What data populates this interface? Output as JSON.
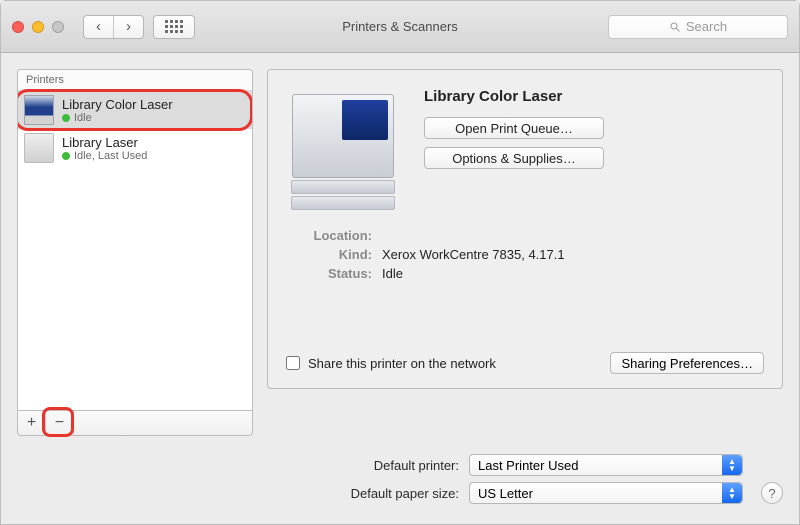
{
  "window": {
    "title": "Printers & Scanners",
    "search_placeholder": "Search"
  },
  "sidebar": {
    "header": "Printers",
    "items": [
      {
        "name": "Library Color Laser",
        "status": "Idle",
        "selected": true
      },
      {
        "name": "Library Laser",
        "status": "Idle, Last Used",
        "selected": false
      }
    ],
    "add_label": "+",
    "remove_label": "−"
  },
  "details": {
    "title": "Library Color Laser",
    "open_queue_label": "Open Print Queue…",
    "options_label": "Options & Supplies…",
    "location_label": "Location:",
    "location_value": "",
    "kind_label": "Kind:",
    "kind_value": "Xerox WorkCentre 7835, 4.17.1",
    "status_label": "Status:",
    "status_value": "Idle",
    "share_label": "Share this printer on the network",
    "sharing_prefs_label": "Sharing Preferences…"
  },
  "defaults": {
    "printer_label": "Default printer:",
    "printer_value": "Last Printer Used",
    "paper_label": "Default paper size:",
    "paper_value": "US Letter",
    "help_label": "?"
  }
}
